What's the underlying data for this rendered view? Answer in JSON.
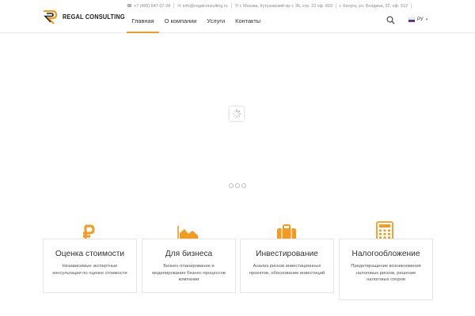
{
  "brand": {
    "logo_text": "REGAL CONSULTING",
    "accent_color": "#f39a1f"
  },
  "topbar": {
    "phone": "+7 (495) 647-07-28",
    "email": "info@regalconsulting.ru",
    "address_moscow": "г. Москва, Кутузовский пр-т, 36, стр. 23 оф. 810",
    "address_kaluga": "г. Калуга, ул. Болдина, 22, оф. 512",
    "icons": [
      "phone-icon",
      "mail-icon",
      "location-pin-icon"
    ]
  },
  "nav": {
    "items": [
      {
        "label": "Главная",
        "active": true
      },
      {
        "label": "О компании",
        "active": false
      },
      {
        "label": "Услуги",
        "active": false
      },
      {
        "label": "Контакты",
        "active": false
      }
    ]
  },
  "header_tools": {
    "search_icon": "search-icon",
    "language": "РУ",
    "language_flag": "russia-flag-icon"
  },
  "slider": {
    "loader_icon": "spinner-icon",
    "slide_count": 3,
    "active_slide": 1
  },
  "services": [
    {
      "title": "Оценка стоимости",
      "description": "Независимые экспертные консультации по оценке стоимости",
      "icon": "ruble-icon"
    },
    {
      "title": "Для бизнеса",
      "description": "Бизнес-планирование и моделирование бизнес-процессов компании",
      "icon": "area-chart-icon"
    },
    {
      "title": "Инвестирование",
      "description": "Анализ рисков инвестиционных проектов, обоснование инвестиций",
      "icon": "briefcase-icon"
    },
    {
      "title": "Налогообложение",
      "description": "Предотвращение возникновения налоговых рисков, решение налоговых споров",
      "icon": "calculator-icon"
    }
  ]
}
